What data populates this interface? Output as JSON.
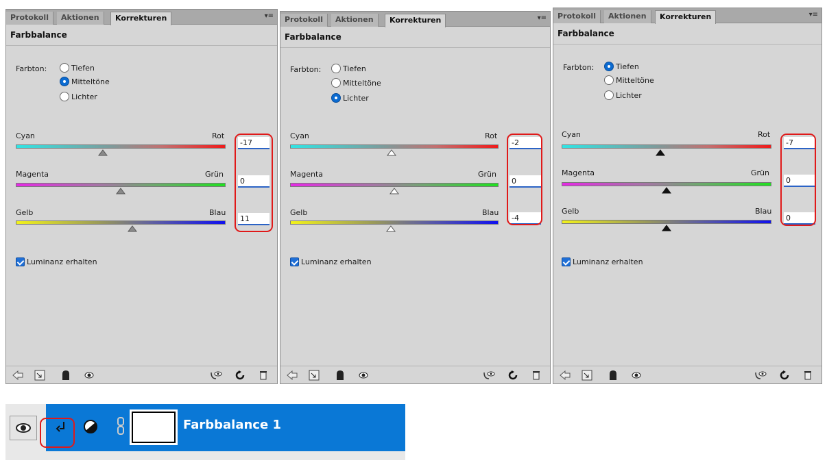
{
  "panels": [
    {
      "tabs": [
        "Protokoll",
        "Aktionen",
        "Korrekturen"
      ],
      "title": "Farbbalance",
      "tone_label": "Farbton:",
      "tones": [
        "Tiefen",
        "Mitteltöne",
        "Lichter"
      ],
      "selected_tone": "Mitteltöne",
      "sliders": [
        {
          "left": "Cyan",
          "right": "Rot",
          "value": "-17"
        },
        {
          "left": "Magenta",
          "right": "Grün",
          "value": "0"
        },
        {
          "left": "Gelb",
          "right": "Blau",
          "value": "11"
        }
      ],
      "preserve_label": "Luminanz erhalten"
    },
    {
      "tabs": [
        "Protokoll",
        "Aktionen",
        "Korrekturen"
      ],
      "title": "Farbbalance",
      "tone_label": "Farbton:",
      "tones": [
        "Tiefen",
        "Mitteltöne",
        "Lichter"
      ],
      "selected_tone": "Lichter",
      "sliders": [
        {
          "left": "Cyan",
          "right": "Rot",
          "value": "-2"
        },
        {
          "left": "Magenta",
          "right": "Grün",
          "value": "0"
        },
        {
          "left": "Gelb",
          "right": "Blau",
          "value": "-4"
        }
      ],
      "preserve_label": "Luminanz erhalten"
    },
    {
      "tabs": [
        "Protokoll",
        "Aktionen",
        "Korrekturen"
      ],
      "title": "Farbbalance",
      "tone_label": "Farbton:",
      "tones": [
        "Tiefen",
        "Mitteltöne",
        "Lichter"
      ],
      "selected_tone": "Tiefen",
      "sliders": [
        {
          "left": "Cyan",
          "right": "Rot",
          "value": "-7"
        },
        {
          "left": "Magenta",
          "right": "Grün",
          "value": "0"
        },
        {
          "left": "Gelb",
          "right": "Blau",
          "value": "0"
        }
      ],
      "preserve_label": "Luminanz erhalten"
    }
  ],
  "layer": {
    "name": "Farbbalance 1"
  },
  "colors": {
    "panel": "#d6d6d6",
    "highlight": "#e01919",
    "selection": "#0a78d6",
    "radio_on": "#0b6bd1"
  }
}
